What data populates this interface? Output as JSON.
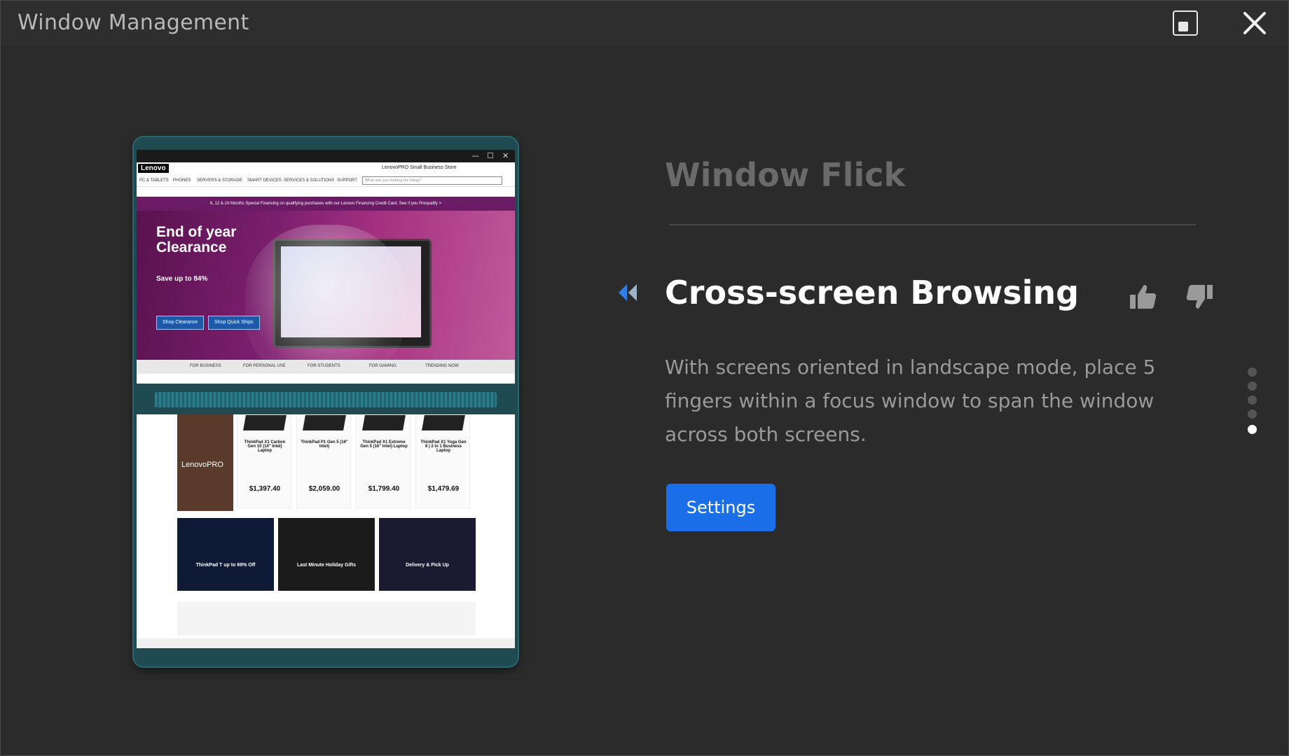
{
  "window": {
    "title": "Window Management"
  },
  "illustration": {
    "brand": "Lenovo",
    "store": "LenovoPRO Small Business Store",
    "nav": [
      "PC & TABLETS",
      "PHONES",
      "SERVERS & STORAGE",
      "SMART DEVICES",
      "SERVICES & SOLUTIONS",
      "SUPPORT"
    ],
    "search_placeholder": "What are you looking for today?",
    "promo": "6, 12 & 24 Months Special Financing on qualifying purchases with our Lenovo Financing Credit Card. See if you Prequalify >",
    "hero_title": "End of year Clearance",
    "hero_save": "Save up to 84%",
    "hero_btn1": "Shop Clearance",
    "hero_btn2": "Shop Quick Ships",
    "tabs": [
      "FOR BUSINESS",
      "FOR PERSONAL USE",
      "FOR STUDENTS",
      "FOR GAMING",
      "TRENDING NOW"
    ],
    "products": [
      {
        "name": "ThinkPad X1 Carbon Gen 10 (14\" Intel) Laptop",
        "price": "$1,397.40"
      },
      {
        "name": "ThinkPad P1 Gen 5 (16\" Intel)",
        "price": "$2,059.00"
      },
      {
        "name": "ThinkPad X1 Extreme Gen 5 (16\" Intel) Laptop",
        "price": "$1,799.40"
      },
      {
        "name": "ThinkPad X1 Yoga Gen 6 | 2 in 1 Business Laptop",
        "price": "$1,479.69"
      }
    ],
    "banners": [
      "ThinkPad T up to 69% Off",
      "Last Minute Holiday Gifts",
      "Delivery & Pick Up"
    ],
    "pro_card": "LenovoPRO"
  },
  "panel": {
    "section_title": "Window Flick",
    "feature_title": "Cross-screen Browsing",
    "description": "With screens oriented in landscape mode, place 5 fingers within a focus window to span the window across both screens.",
    "settings_label": "Settings",
    "page_count": 5,
    "active_page": 5
  },
  "colors": {
    "accent": "#1a6fe8",
    "back_arrow": "#2f7fe6"
  }
}
